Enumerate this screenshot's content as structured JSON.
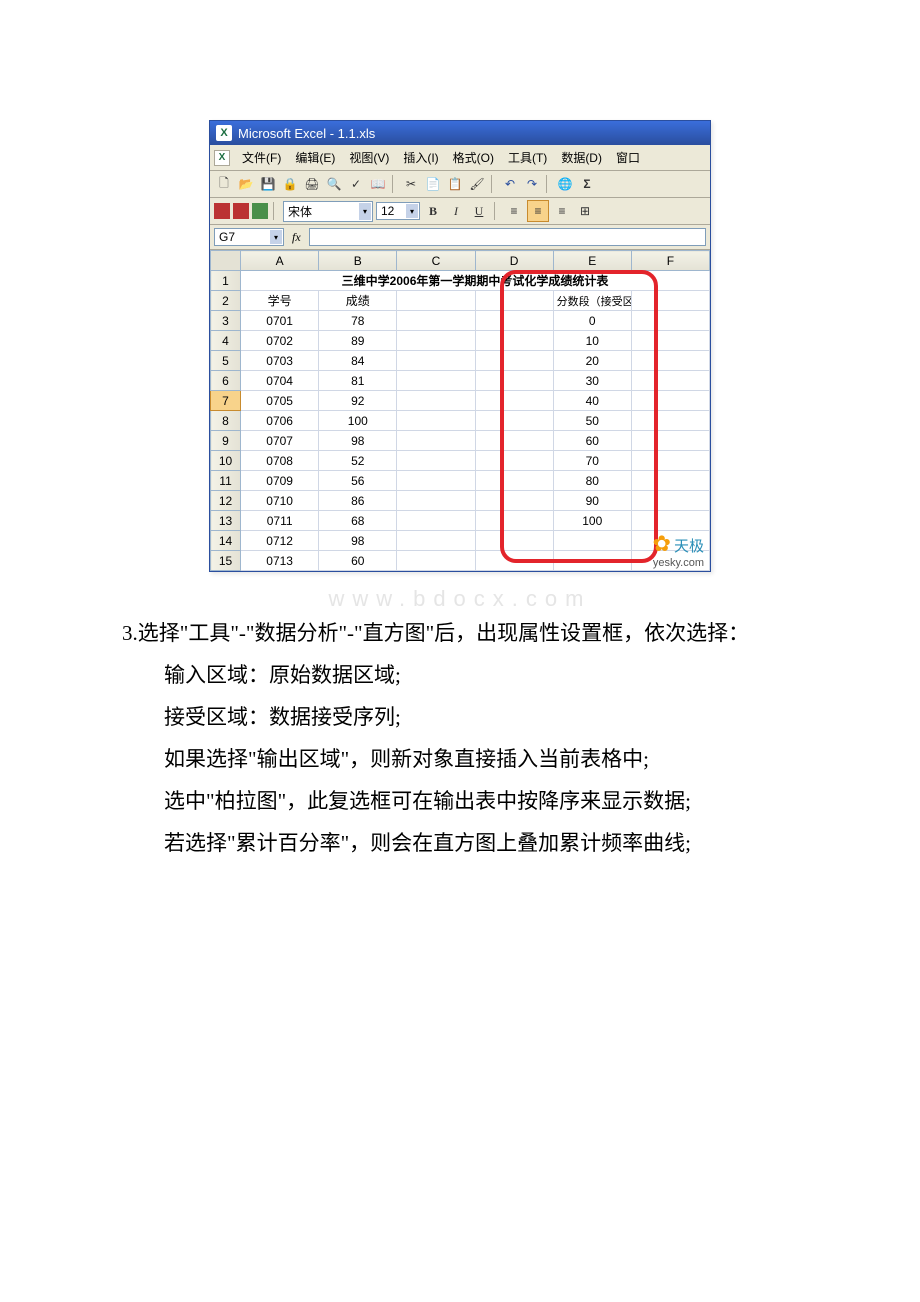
{
  "excel": {
    "title": "Microsoft Excel - 1.1.xls",
    "menus": {
      "file": "文件(F)",
      "edit": "编辑(E)",
      "view": "视图(V)",
      "insert": "插入(I)",
      "format": "格式(O)",
      "tools": "工具(T)",
      "data": "数据(D)",
      "window": "窗口"
    },
    "font_name": "宋体",
    "font_size": "12",
    "namebox": "G7",
    "columns": [
      "A",
      "B",
      "C",
      "D",
      "E",
      "F"
    ],
    "selected_row_header": "7",
    "sheet_title": "三维中学2006年第一学期期中考试化学成绩统计表",
    "header_a": "学号",
    "header_b": "成绩",
    "header_e": "分数段（接受区域）",
    "rows": [
      {
        "n": "3",
        "a": "0701",
        "b": "78",
        "e": "0"
      },
      {
        "n": "4",
        "a": "0702",
        "b": "89",
        "e": "10"
      },
      {
        "n": "5",
        "a": "0703",
        "b": "84",
        "e": "20"
      },
      {
        "n": "6",
        "a": "0704",
        "b": "81",
        "e": "30"
      },
      {
        "n": "7",
        "a": "0705",
        "b": "92",
        "e": "40"
      },
      {
        "n": "8",
        "a": "0706",
        "b": "100",
        "e": "50"
      },
      {
        "n": "9",
        "a": "0707",
        "b": "98",
        "e": "60"
      },
      {
        "n": "10",
        "a": "0708",
        "b": "52",
        "e": "70"
      },
      {
        "n": "11",
        "a": "0709",
        "b": "56",
        "e": "80"
      },
      {
        "n": "12",
        "a": "0710",
        "b": "86",
        "e": "90"
      },
      {
        "n": "13",
        "a": "0711",
        "b": "68",
        "e": "100"
      },
      {
        "n": "14",
        "a": "0712",
        "b": "98",
        "e": ""
      },
      {
        "n": "15",
        "a": "0713",
        "b": "60",
        "e": ""
      }
    ],
    "logo_brand": "天极",
    "logo_url": "yesky.com"
  },
  "doc": {
    "watermark": "www.bdocx.com",
    "p1": "3.选择\"工具\"-\"数据分析\"-\"直方图\"后，出现属性设置框，依次选择：",
    "p2": "输入区域：原始数据区域;",
    "p3": "接受区域：数据接受序列;",
    "p4": "如果选择\"输出区域\"，则新对象直接插入当前表格中;",
    "p5": "选中\"柏拉图\"，此复选框可在输出表中按降序来显示数据;",
    "p6": "若选择\"累计百分率\"，则会在直方图上叠加累计频率曲线;"
  }
}
